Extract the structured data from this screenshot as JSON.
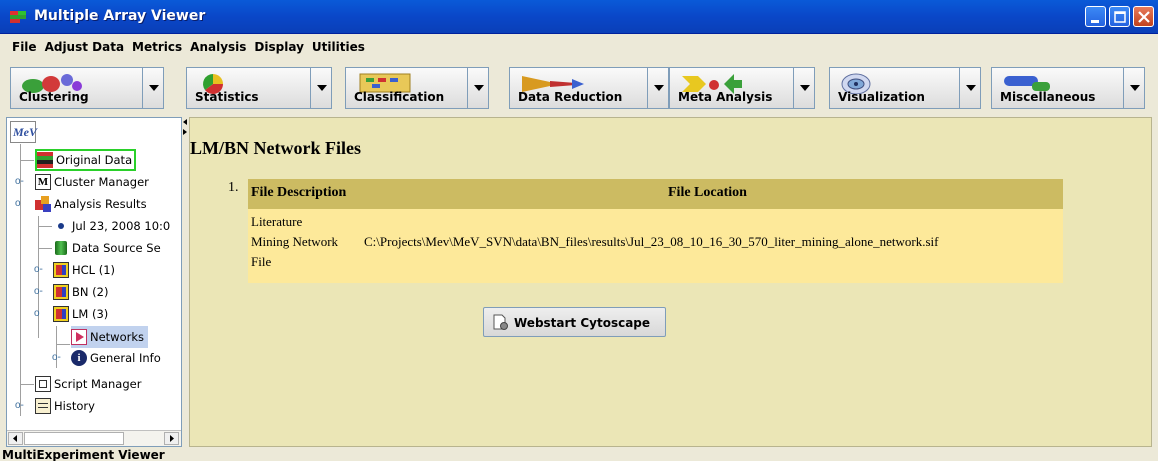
{
  "window": {
    "title": "Multiple Array Viewer",
    "controls": [
      "minimize-icon",
      "maximize-icon",
      "close-icon"
    ]
  },
  "menu": [
    "File",
    "Adjust Data",
    "Metrics",
    "Analysis",
    "Display",
    "Utilities"
  ],
  "toolbar": [
    {
      "label": "Clustering",
      "icon": "clustering-icon"
    },
    {
      "label": "Statistics",
      "icon": "statistics-icon"
    },
    {
      "label": "Classification",
      "icon": "classification-icon"
    },
    {
      "label": "Data Reduction",
      "icon": "data-reduction-icon"
    },
    {
      "label": "Meta Analysis",
      "icon": "meta-analysis-icon"
    },
    {
      "label": "Visualization",
      "icon": "visualization-icon"
    },
    {
      "label": "Miscellaneous",
      "icon": "miscellaneous-icon"
    }
  ],
  "tree": {
    "root_logo": "MeV",
    "items": [
      {
        "label": "Original Data",
        "icon": "heatmap-icon",
        "selected_box": true
      },
      {
        "label": "Cluster Manager",
        "icon": "cluster-manager-icon"
      },
      {
        "label": "Analysis Results",
        "icon": "analysis-results-icon"
      },
      {
        "label": "Jul 23, 2008 10:0",
        "icon": "bullet-icon"
      },
      {
        "label": "Data Source Se",
        "icon": "data-source-icon"
      },
      {
        "label": "HCL (1)",
        "icon": "result-node-icon"
      },
      {
        "label": "BN (2)",
        "icon": "result-node-icon"
      },
      {
        "label": "LM (3)",
        "icon": "result-node-icon"
      },
      {
        "label": "Networks",
        "icon": "network-icon",
        "selected": true
      },
      {
        "label": "General Info",
        "icon": "info-icon"
      },
      {
        "label": "Script Manager",
        "icon": "script-manager-icon"
      },
      {
        "label": "History",
        "icon": "history-icon"
      }
    ]
  },
  "main": {
    "title": "LM/BN Network Files",
    "entry_number": "1.",
    "headers": {
      "description": "File Description",
      "location": "File Location"
    },
    "description_lines": [
      "Literature",
      "Mining Network",
      "File"
    ],
    "location": "C:\\Projects\\Mev\\MeV_SVN\\data\\BN_files\\results\\Jul_23_08_10_16_30_570_liter_mining_alone_network.sif",
    "button": "Webstart Cytoscape"
  },
  "status": "MultiExperiment Viewer",
  "colors": {
    "titlebar": "#0a47c8",
    "panel_bg": "#ebe6b6",
    "header_bg": "#ccbb62",
    "row_bg": "#fde99a",
    "selection": "#c1d2ee"
  }
}
